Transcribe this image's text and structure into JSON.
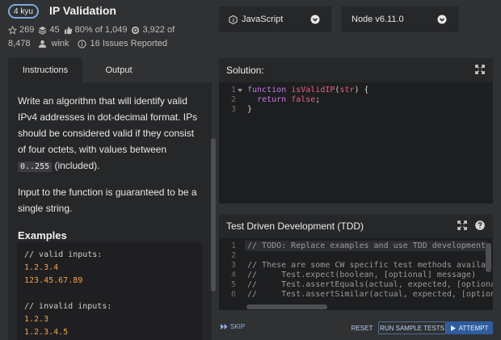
{
  "kata": {
    "rank": "4 kyu",
    "title": "IP Validation",
    "stats": {
      "stars": "269",
      "collections": "45",
      "satisfaction": "80% of 1,049",
      "completed_a": "3,922 of",
      "completed_b": "8,478",
      "author": "wink",
      "issues": "16 Issues Reported"
    }
  },
  "tabs": {
    "instructions": "Instructions",
    "output": "Output"
  },
  "instructions": {
    "para1_before": "Write an algorithm that will identify valid IPv4 addresses in dot-decimal format. IPs should be considered valid if they consist of four octets, with values between ",
    "range_code": "0..255",
    "para1_after": " (included).",
    "para2": "Input to the function is guaranteed to be a single string.",
    "examples_heading": "Examples",
    "examples": {
      "valid_comment": "// valid inputs:",
      "valid": [
        "1.2.3.4",
        "123.45.67.89"
      ],
      "invalid_comment": "// invalid inputs:",
      "invalid": [
        "1.2.3",
        "1.2.3.4.5"
      ]
    }
  },
  "language": {
    "selected": "JavaScript"
  },
  "version": {
    "selected": "Node v6.11.0"
  },
  "solution": {
    "title": "Solution:",
    "line_numbers": [
      "1",
      "2",
      "3"
    ],
    "code": {
      "l1_kw": "function",
      "l1_fn": "isValidIP",
      "l1_open": "(",
      "l1_arg": "str",
      "l1_close": ") {",
      "l2_kw": "return",
      "l2_val": "false",
      "l2_end": ";",
      "l3": "}"
    }
  },
  "tdd": {
    "title": "Test Driven Development (TDD)",
    "line_numbers": [
      "1",
      "2",
      "3",
      "4",
      "5",
      "6"
    ],
    "lines": [
      "// TODO: Replace examples and use TDD development",
      "",
      "// These are some CW specific test methods availab",
      "//     Test.expect(boolean, [optional] message)",
      "//     Test.assertEquals(actual, expected, [optiona",
      "//     Test.assertSimilar(actual, expected, [option"
    ]
  },
  "actions": {
    "skip": "SKIP",
    "reset": "RESET",
    "run_tests": "RUN SAMPLE TESTS",
    "attempt": "ATTEMPT"
  },
  "colors": {
    "accent_blue": "#2e5d9e",
    "example_orange": "#f0a54d",
    "keyword_purple": "#c678dd",
    "identifier_pink": "#ea5d8a"
  },
  "icons": {
    "star": "star-icon",
    "collections": "layers-icon",
    "satisfaction": "thumbs-up-icon",
    "completed": "target-icon",
    "author": "user-icon",
    "issues": "info-icon",
    "language": "javascript-icon",
    "chevron": "chevron-down-icon",
    "expand": "expand-icon",
    "help": "help-icon",
    "skip": "fast-forward-icon",
    "attempt": "play-icon"
  }
}
